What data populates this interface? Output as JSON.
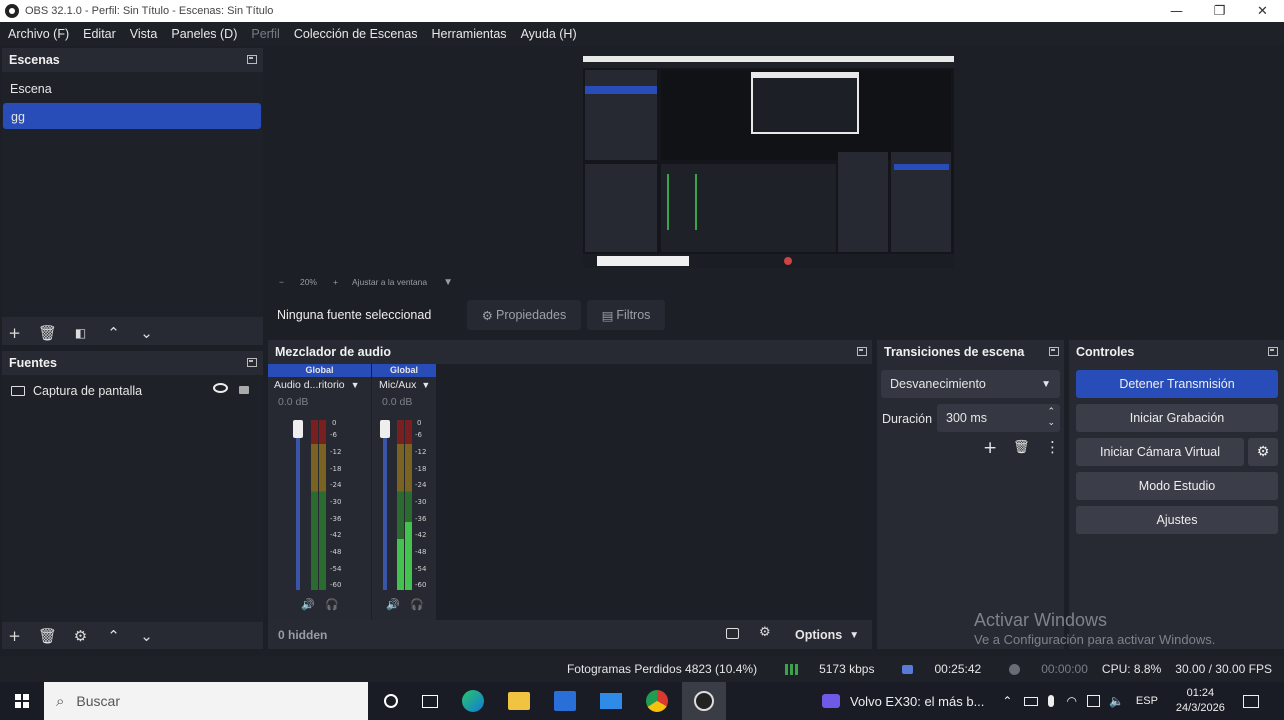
{
  "window": {
    "title": "OBS 32.1.0 - Perfil: Sin Título - Escenas: Sin Título",
    "minimize": "—",
    "maximize": "❐",
    "close": "✕"
  },
  "menu": {
    "items": [
      "Archivo (F)",
      "Editar",
      "Vista",
      "Paneles (D)",
      "Perfil",
      "Colección de Escenas",
      "Herramientas",
      "Ayuda (H)"
    ]
  },
  "scenes": {
    "header": "Escenas",
    "items": [
      "Escena",
      "gg"
    ],
    "selected_index": 1
  },
  "preview": {
    "zoom": "20%",
    "fit_label": "Ajustar a la ventana"
  },
  "source_toolbar": {
    "no_source": "Ninguna fuente seleccionad",
    "properties": "Propiedades",
    "filters": "Filtros"
  },
  "sources": {
    "header": "Fuentes",
    "items": [
      "Captura de pantalla"
    ]
  },
  "mixer": {
    "header": "Mezclador de audio",
    "channels": [
      {
        "scope": "Global",
        "name": "Audio d...ritorio",
        "db": "0.0 dB",
        "level": 0.62
      },
      {
        "scope": "Global",
        "name": "Mic/Aux",
        "db": "0.0 dB",
        "level": 0.45
      }
    ],
    "scale": [
      "0",
      "-6",
      "-12",
      "-18",
      "-24",
      "-30",
      "-36",
      "-42",
      "-48",
      "-54",
      "-60"
    ],
    "hidden": "0 hidden",
    "options": "Options"
  },
  "transitions": {
    "header": "Transiciones de escena",
    "selected": "Desvanecimiento",
    "duration_label": "Duración",
    "duration_value": "300 ms"
  },
  "controls": {
    "header": "Controles",
    "stop_stream": "Detener Transmisión",
    "start_recording": "Iniciar Grabación",
    "virtual_cam": "Iniciar Cámara Virtual",
    "studio_mode": "Modo Estudio",
    "settings": "Ajustes"
  },
  "watermark": {
    "line1": "Activar Windows",
    "line2": "Ve a Configuración para activar Windows."
  },
  "statusbar": {
    "dropped": "Fotogramas Perdidos 4823 (10.4%)",
    "bitrate": "5173 kbps",
    "stream_time": "00:25:42",
    "rec_time": "00:00:00",
    "cpu": "CPU: 8.8%",
    "fps": "30.00 / 30.00 FPS"
  },
  "taskbar": {
    "search_placeholder": "Buscar",
    "media": "Volvo EX30: el más b...",
    "lang": "ESP",
    "time": "01:24",
    "date": "24/3/2026"
  },
  "colors": {
    "accent": "#284cb8",
    "panel": "#272a33",
    "background": "#1d1f26"
  }
}
